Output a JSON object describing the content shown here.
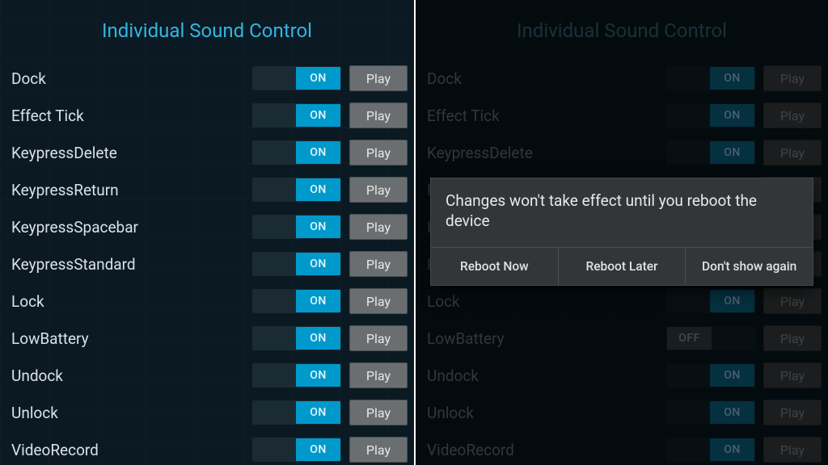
{
  "title": "Individual Sound Control",
  "toggle_on_text": "ON",
  "toggle_off_text": "OFF",
  "play_label": "Play",
  "left": {
    "rows": [
      {
        "label": "Dock",
        "on": true
      },
      {
        "label": "Effect Tick",
        "on": true
      },
      {
        "label": "KeypressDelete",
        "on": true
      },
      {
        "label": "KeypressReturn",
        "on": true
      },
      {
        "label": "KeypressSpacebar",
        "on": true
      },
      {
        "label": "KeypressStandard",
        "on": true
      },
      {
        "label": "Lock",
        "on": true
      },
      {
        "label": "LowBattery",
        "on": true
      },
      {
        "label": "Undock",
        "on": true
      },
      {
        "label": "Unlock",
        "on": true
      },
      {
        "label": "VideoRecord",
        "on": true
      }
    ]
  },
  "right": {
    "rows": [
      {
        "label": "Dock",
        "on": true
      },
      {
        "label": "Effect Tick",
        "on": true
      },
      {
        "label": "KeypressDelete",
        "on": true
      },
      {
        "label": "KeypressReturn",
        "on": true
      },
      {
        "label": "KeypressSpacebar",
        "on": true
      },
      {
        "label": "KeypressStandard",
        "on": true
      },
      {
        "label": "Lock",
        "on": true
      },
      {
        "label": "LowBattery",
        "on": false
      },
      {
        "label": "Undock",
        "on": true
      },
      {
        "label": "Unlock",
        "on": true
      },
      {
        "label": "VideoRecord",
        "on": true
      }
    ],
    "dialog": {
      "message": "Changes won't take effect until you reboot the device",
      "buttons": [
        "Reboot Now",
        "Reboot Later",
        "Don't show again"
      ]
    }
  }
}
